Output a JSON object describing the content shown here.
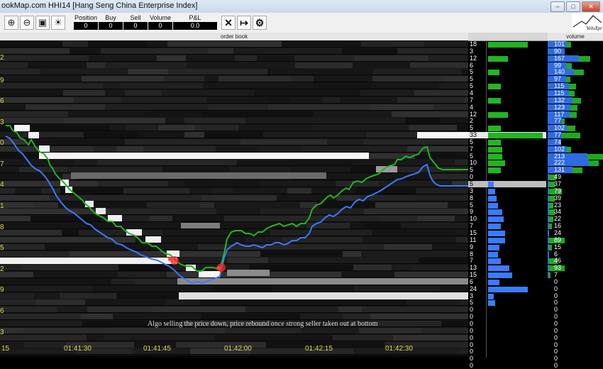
{
  "window": {
    "title": "ookMap.com   HHI14 [Hang Seng China Enterprise Index]",
    "controls": [
      "minimize",
      "restore",
      "close"
    ]
  },
  "toolbar": {
    "left_icons": [
      "zoom-in-icon",
      "zoom-out-icon",
      "camera-icon",
      "brightness-icon"
    ],
    "stats": [
      {
        "label": "Position",
        "value": "0"
      },
      {
        "label": "Buy",
        "value": "0"
      },
      {
        "label": "Sell",
        "value": "0"
      },
      {
        "label": "Volume",
        "value": "0"
      },
      {
        "label": "P&L",
        "value": "0.0"
      }
    ],
    "right_icons": [
      "close-x-icon",
      "exit-icon",
      "gear-icon"
    ],
    "logo_text": "VeloXpr"
  },
  "headers": {
    "order_book": "order book",
    "volume": "volume"
  },
  "price_labels": [
    "2",
    "9",
    "6",
    "3",
    "0",
    "7",
    "4",
    "1",
    "8",
    "5",
    "2",
    "9",
    "6",
    "3"
  ],
  "order_book_rows": [
    18,
    3,
    12,
    6,
    5,
    5,
    5,
    4,
    7,
    4,
    12,
    2,
    5,
    33,
    5,
    7,
    5,
    10,
    5,
    0,
    5,
    3,
    8,
    5,
    9,
    10,
    7,
    15,
    11,
    9,
    8,
    7,
    13,
    15,
    6,
    24,
    3,
    5,
    0,
    0,
    0,
    0,
    0,
    0,
    0,
    0,
    0
  ],
  "order_book_green": [
    56,
    0,
    28,
    0,
    16,
    0,
    18,
    0,
    18,
    0,
    28,
    0,
    18,
    77,
    18,
    20,
    20,
    24,
    18,
    0,
    0,
    0,
    0,
    0,
    0,
    0,
    0,
    0,
    0,
    0,
    0,
    0,
    0,
    0,
    0,
    0,
    0,
    0,
    0,
    0,
    0,
    0,
    0,
    0,
    0,
    0,
    0
  ],
  "order_book_blue": [
    0,
    0,
    0,
    0,
    0,
    0,
    0,
    0,
    0,
    0,
    0,
    0,
    0,
    0,
    0,
    0,
    0,
    0,
    0,
    0,
    8,
    10,
    12,
    14,
    20,
    22,
    18,
    24,
    24,
    16,
    14,
    18,
    30,
    34,
    16,
    56,
    8,
    10,
    0,
    0,
    0,
    0,
    0,
    0,
    0,
    0,
    0
  ],
  "volume_rows": [
    {
      "label": "101",
      "blue": 27,
      "green": 6
    },
    {
      "label": "90",
      "blue": 24,
      "green": 0
    },
    {
      "label": "167",
      "blue": 44,
      "green": 16
    },
    {
      "label": "99",
      "blue": 26,
      "green": 8
    },
    {
      "label": "140",
      "blue": 37,
      "green": 14
    },
    {
      "label": "97",
      "blue": 26,
      "green": 6
    },
    {
      "label": "115",
      "blue": 30,
      "green": 10
    },
    {
      "label": "115",
      "blue": 30,
      "green": 8
    },
    {
      "label": "132",
      "blue": 35,
      "green": 12
    },
    {
      "label": "123",
      "blue": 32,
      "green": 10
    },
    {
      "label": "117",
      "blue": 31,
      "green": 10
    },
    {
      "label": "77",
      "blue": 20,
      "green": 4
    },
    {
      "label": "102",
      "blue": 27,
      "green": 12
    },
    {
      "label": "77",
      "blue": 20,
      "green": 26
    },
    {
      "label": "74",
      "blue": 19,
      "green": 0
    },
    {
      "label": "102",
      "blue": 27,
      "green": 6
    },
    {
      "label": "213",
      "blue": 56,
      "green": 22
    },
    {
      "label": "222",
      "blue": 58,
      "green": 14
    },
    {
      "label": "131",
      "blue": 35,
      "green": 14
    },
    {
      "label": "49",
      "blue": 2,
      "green": 10
    },
    {
      "label": "37",
      "blue": 2,
      "green": 8
    },
    {
      "label": "79",
      "blue": 2,
      "green": 18
    },
    {
      "label": "39",
      "blue": 2,
      "green": 8
    },
    {
      "label": "23",
      "blue": 2,
      "green": 6
    },
    {
      "label": "34",
      "blue": 2,
      "green": 8
    },
    {
      "label": "22",
      "blue": 2,
      "green": 6
    },
    {
      "label": "16",
      "blue": 2,
      "green": 4
    },
    {
      "label": "24",
      "blue": 2,
      "green": 0
    },
    {
      "label": "89",
      "blue": 2,
      "green": 22
    },
    {
      "label": "15",
      "blue": 2,
      "green": 4
    },
    {
      "label": "6",
      "blue": 2,
      "green": 0
    },
    {
      "label": "46",
      "blue": 2,
      "green": 12
    },
    {
      "label": "93",
      "blue": 2,
      "green": 22
    },
    {
      "label": "7",
      "blue": 2,
      "green": 2
    },
    {
      "label": "0",
      "blue": 0,
      "green": 0
    },
    {
      "label": "0",
      "blue": 0,
      "green": 0
    },
    {
      "label": "0",
      "blue": 0,
      "green": 0
    },
    {
      "label": "0",
      "blue": 0,
      "green": 0
    },
    {
      "label": "0",
      "blue": 0,
      "green": 0
    },
    {
      "label": "0",
      "blue": 0,
      "green": 0
    },
    {
      "label": "0",
      "blue": 0,
      "green": 0
    },
    {
      "label": "0",
      "blue": 0,
      "green": 0
    },
    {
      "label": "0",
      "blue": 0,
      "green": 0
    },
    {
      "label": "0",
      "blue": 0,
      "green": 0
    },
    {
      "label": "0",
      "blue": 0,
      "green": 0
    },
    {
      "label": "0",
      "blue": 0,
      "green": 0
    },
    {
      "label": "0",
      "blue": 0,
      "green": 0
    }
  ],
  "annotation": "Algo selling the price down, price rebound once strong seller taken out at bottom",
  "time_axis": [
    "15",
    "01:41:30",
    "01:41:45",
    "01:42:00",
    "01:42:15",
    "01:42:30"
  ],
  "colors": {
    "bid_line": "#3a7bff",
    "ask_line": "#22b522",
    "trade_dot": "#ff2020",
    "axis_text": "#e6d94a"
  }
}
